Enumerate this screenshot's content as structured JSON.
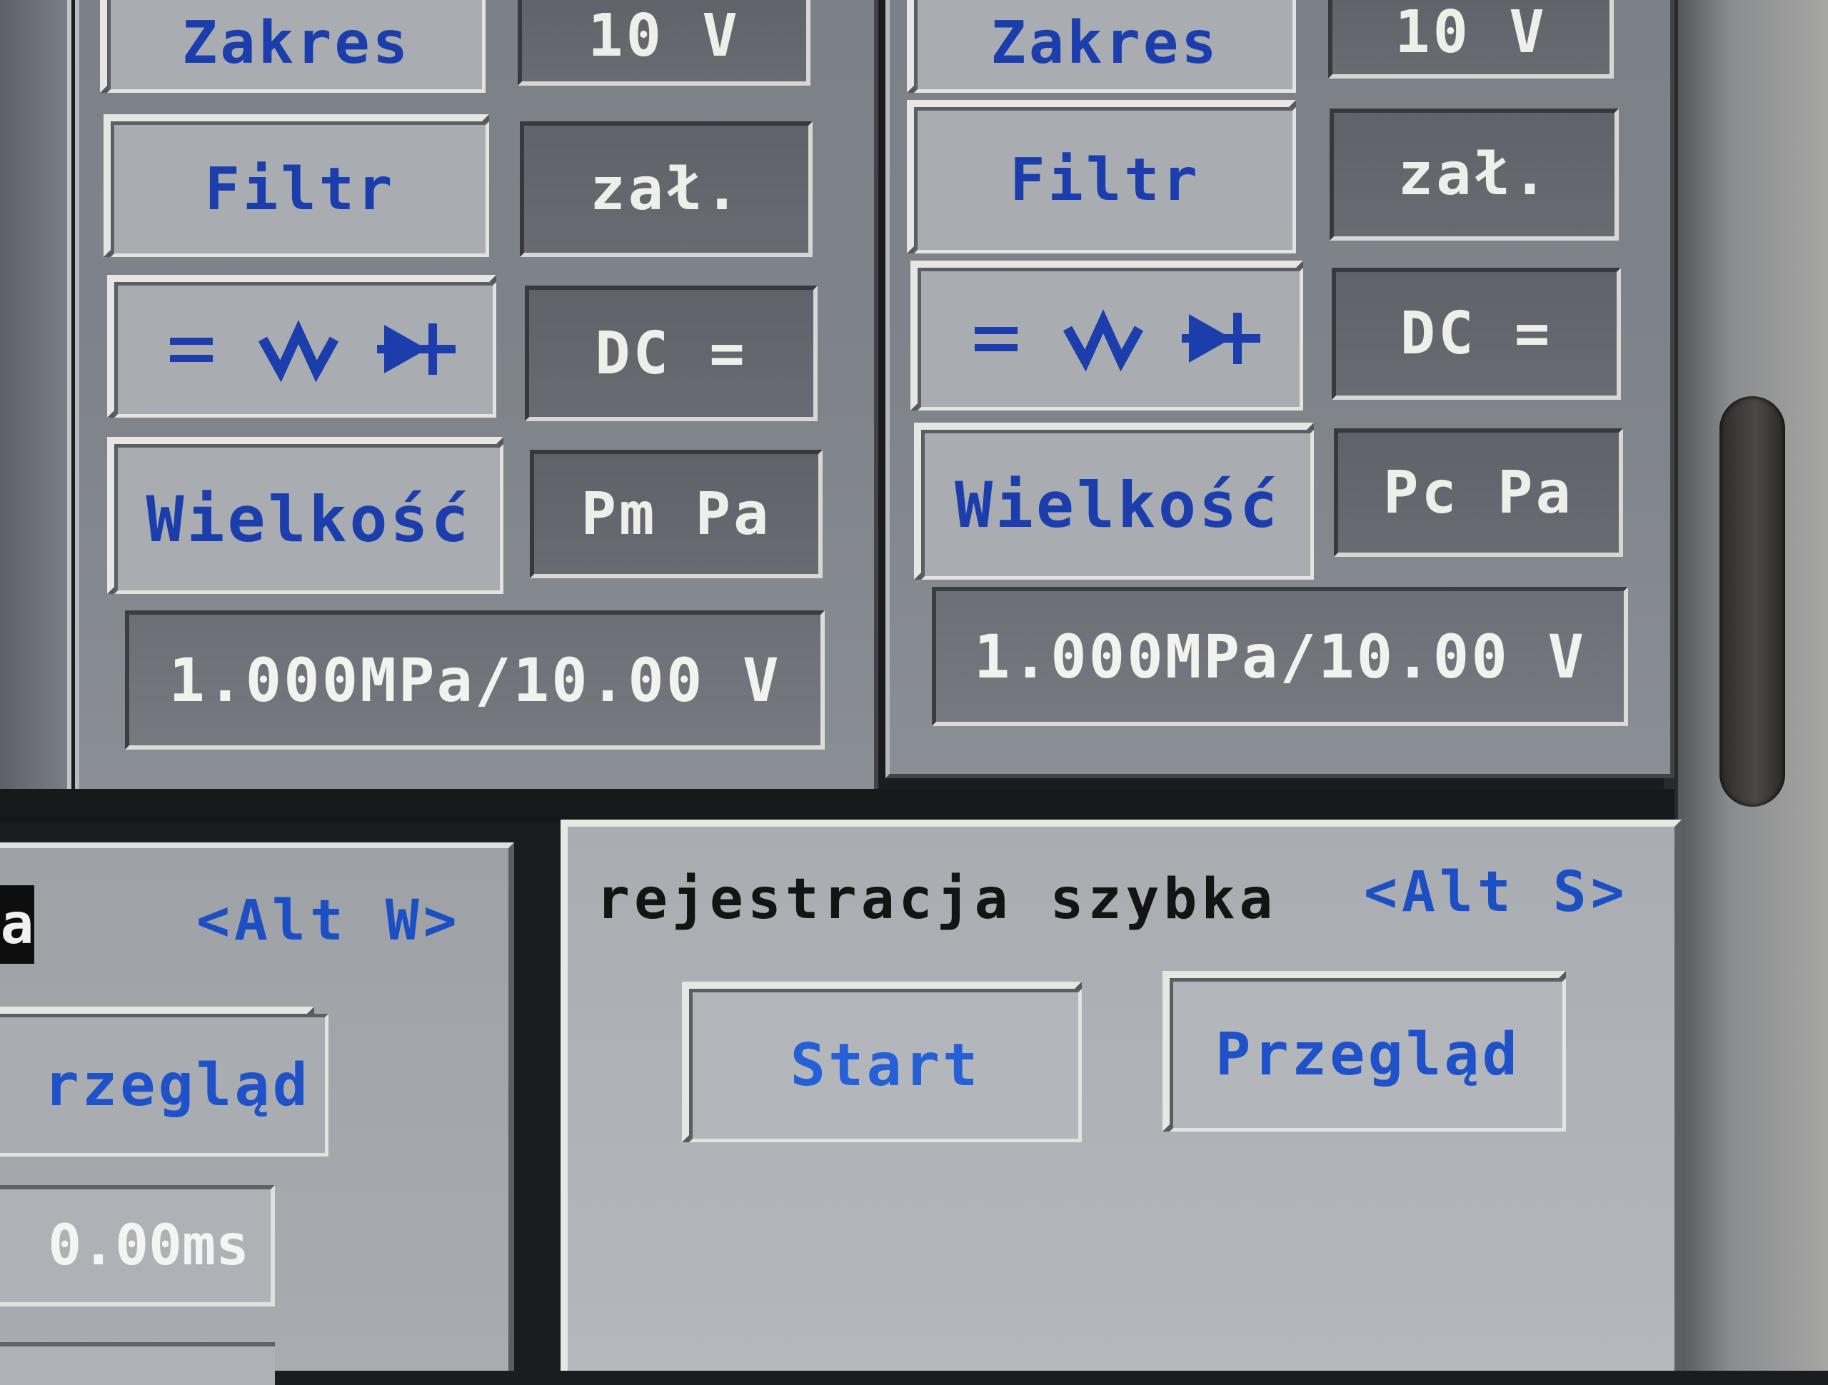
{
  "channels": [
    {
      "range_label": "Zakres",
      "range_value": "10 V",
      "filter_label": "Filtr",
      "filter_value": "zał.",
      "coupling_label": "= ⋀⋁ ➔",
      "coupling_value": "DC =",
      "quantity_label": "Wielkość",
      "quantity_value": "Pm Pa",
      "scale": "1.000MPa/10.00 V"
    },
    {
      "range_label": "Zakres",
      "range_value": "10 V",
      "filter_label": "Filtr",
      "filter_value": "zał.",
      "coupling_label": "= ⋀⋁ ➔",
      "coupling_value": "DC =",
      "quantity_label": "Wielkość",
      "quantity_value": "Pc Pa",
      "scale": "1.000MPa/10.00 V"
    }
  ],
  "left_panel": {
    "title_fragment": "a",
    "hotkey": "<Alt W>",
    "review_button": "rzegląd",
    "time_value": "0.00ms"
  },
  "fast_recording": {
    "title": "rejestracja szybka",
    "hotkey": "<Alt S>",
    "start_button": "Start",
    "review_button": "Przegląd"
  },
  "colors": {
    "button_text": "#1c3dac",
    "hotkey_text": "#1d4fc4",
    "panel_bg": "#7f838a",
    "value_bg": "#64686e"
  }
}
